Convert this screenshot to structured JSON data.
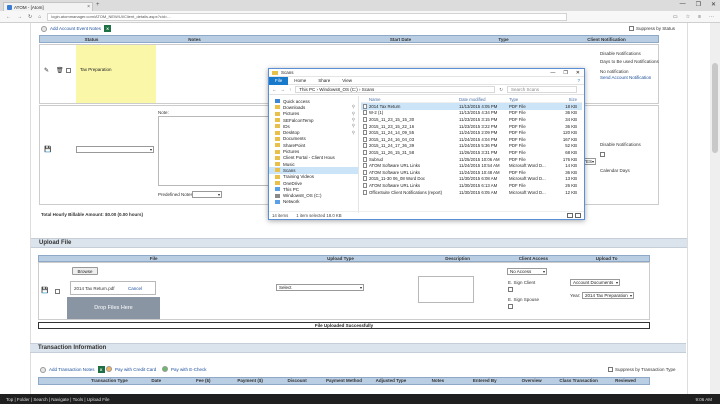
{
  "browser": {
    "tab_title": "ATOM - [Atom]",
    "url": "login.atommanager.com/ATOM_NEW/UI/Client_details.aspx?cid=...",
    "controls": [
      "—",
      "❐",
      "✕"
    ]
  },
  "page": {
    "client_notes": {
      "add_label": "Add Account Event Notes",
      "toggle_label": "Suppress by Status",
      "grid_headers": [
        "Status",
        "Notes",
        "",
        "Start Date",
        "Type",
        "Client Notification"
      ],
      "status_value": "Tax Preparation",
      "note_label": "Note:",
      "predefined_label": "Predefined Notes",
      "total_label": "Total Hourly Billable Amount: $0.00 (0.00 hours)",
      "notify_1": "Disable Notifications",
      "notify_2": "Days to Be used Notifications",
      "notify_3": "No notification",
      "notify_4": "Send Account Notification",
      "notify_5": "Disable Notifications",
      "notify_6": "Calendar Days",
      "notify_value": "YES"
    },
    "upload": {
      "section_title": "Upload File",
      "headers": [
        "File",
        "Upload Type",
        "Description",
        "Client Access",
        "Upload To"
      ],
      "browse_label": "Browse",
      "file_name": "2014 Tax Return.pdf",
      "cancel_label": "Cancel",
      "drop_label": "Drop Files Here",
      "upload_type_value": "Select",
      "client_access_value": "No Access",
      "sign_client_label": "E. Sign Client",
      "sign_spouse_label": "E. Sign Spouse",
      "upload_to_value": "Account Documents",
      "year_label": "Year:",
      "year_value": "2014 Tax Preparation",
      "success_text": "File Uploaded Successfully"
    },
    "transactions": {
      "section_title": "Transaction Information",
      "add_label": "Add Transaction Notes",
      "pay_credit_label": "Pay with Credit Card",
      "pay_check_label": "Pay with E-Check",
      "suppress_label": "Suppress by Transaction Type",
      "headers": [
        "",
        "Transaction Type",
        "Date",
        "Fee ($)",
        "Payment ($)",
        "Discount",
        "Payment Method",
        "Adjusted Type",
        "Notes",
        "Entered By",
        "Overview",
        "Class Transaction",
        "Reviewed"
      ]
    }
  },
  "explorer": {
    "title": "Scans",
    "ribbon_tabs": [
      "File",
      "Home",
      "Share",
      "View"
    ],
    "path": "This PC  ›  Windows8_OS (C:)  ›  Scans",
    "search_placeholder": "Search Scans",
    "nav_items": [
      {
        "label": "Quick access",
        "icon": "star-icon"
      },
      {
        "label": "Downloads",
        "icon": "folder-icon"
      },
      {
        "label": "Pictures",
        "icon": "folder-icon"
      },
      {
        "label": "SEFalconTemp",
        "icon": "folder-icon"
      },
      {
        "label": "IDs",
        "icon": "folder-icon"
      },
      {
        "label": "Desktop",
        "icon": "folder-icon"
      },
      {
        "label": "Documents",
        "icon": "folder-icon"
      },
      {
        "label": "SharePoint",
        "icon": "folder-icon"
      },
      {
        "label": "Pictures",
        "icon": "folder-icon"
      },
      {
        "label": "Client Portal - Client Hous",
        "icon": "folder-icon"
      },
      {
        "label": "Music",
        "icon": "folder-icon"
      },
      {
        "label": "Scans",
        "icon": "folder-icon"
      },
      {
        "label": "Training Videos",
        "icon": "folder-icon"
      },
      {
        "label": "OneDrive",
        "icon": "folder-icon"
      },
      {
        "label": "This PC",
        "icon": "pc-icon"
      },
      {
        "label": "Windows8_OS (C:)",
        "icon": "drive-icon"
      },
      {
        "label": "Network",
        "icon": "pc-icon"
      }
    ],
    "columns": [
      "Name",
      "Date modified",
      "Type",
      "Size"
    ],
    "files": [
      {
        "name": "2014 Tax Return",
        "date": "11/13/2015 4:05 PM",
        "type": "PDF File",
        "size": "18 KB"
      },
      {
        "name": "W-2 (1)",
        "date": "11/13/2015 4:34 PM",
        "type": "PDF File",
        "size": "36 KB"
      },
      {
        "name": "2015_11_23_15_15_30",
        "date": "11/23/2015 3:15 PM",
        "type": "PDF File",
        "size": "34 KB"
      },
      {
        "name": "2015_11_23_15_22_16",
        "date": "11/23/2015 3:22 PM",
        "type": "PDF File",
        "size": "36 KB"
      },
      {
        "name": "2015_11_24_14_09_55",
        "date": "11/24/2015 2:09 PM",
        "type": "PDF File",
        "size": "120 KB"
      },
      {
        "name": "2015_11_24_16_04_03",
        "date": "11/24/2015 4:04 PM",
        "type": "PDF File",
        "size": "167 KB"
      },
      {
        "name": "2015_11_24_17_36_39",
        "date": "11/24/2015 5:36 PM",
        "type": "PDF File",
        "size": "52 KB"
      },
      {
        "name": "2015_11_26_15_31_58",
        "date": "11/26/2015 3:31 PM",
        "type": "PDF File",
        "size": "68 KB"
      },
      {
        "name": "Subrud",
        "date": "11/25/2015 10:06 AM",
        "type": "PDF File",
        "size": "176 KB"
      },
      {
        "name": "ATOM Software URL Links",
        "date": "11/24/2015 10:54 AM",
        "type": "Microsoft Word D...",
        "size": "14 KB"
      },
      {
        "name": "ATOM Software URL Links",
        "date": "11/24/2015 10:48 AM",
        "type": "PDF File",
        "size": "36 KB"
      },
      {
        "name": "2015_11-30 06_08 Word Doc",
        "date": "11/30/2015 6:08 AM",
        "type": "Microsoft Word D...",
        "size": "13 KB"
      },
      {
        "name": "ATOM Software URL Links",
        "date": "11/30/2015 6:13 AM",
        "type": "PDF File",
        "size": "26 KB"
      },
      {
        "name": "OfficeSuite Client Notifications (report)",
        "date": "11/30/2015 6:05 AM",
        "type": "Microsoft Word D...",
        "size": "12 KB"
      }
    ],
    "status_items": "14 items",
    "status_selected": "1 item selected  18.0 KB"
  },
  "taskbar": {
    "apps": "Top | Folder | Search | Navigate | Tools | Upload File",
    "clock": "9:06 AM"
  }
}
